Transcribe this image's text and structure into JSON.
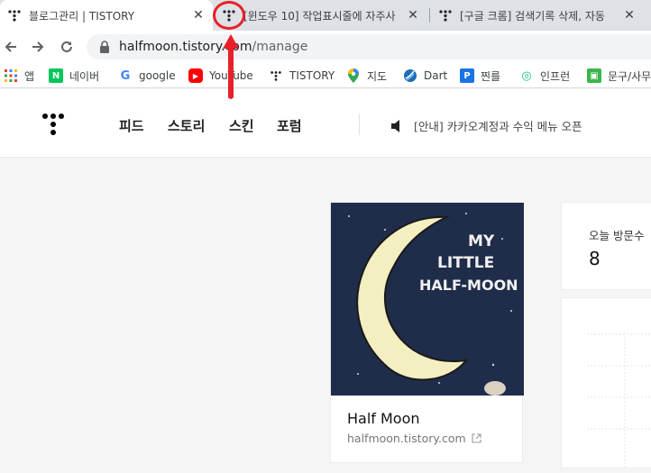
{
  "browser": {
    "tabs": [
      {
        "title": "블로그관리 | TISTORY",
        "active": true
      },
      {
        "title": "[윈도우 10] 작업표시줄에 자주사",
        "active": false
      },
      {
        "title": "[구글 크롬] 검색기록 삭제, 자동",
        "active": false
      }
    ],
    "close_glyph": "✕",
    "url_host": "halfmoon.tistory.com",
    "url_path": "/manage"
  },
  "bookmarks": [
    {
      "label": "앱",
      "icon": "apps-grid-icon"
    },
    {
      "label": "네이버",
      "icon": "naver-icon",
      "color": "#03c75a",
      "glyph": "N"
    },
    {
      "label": "google",
      "icon": "google-icon",
      "color": "#4285f4",
      "glyph": "G"
    },
    {
      "label": "YouTube",
      "icon": "youtube-icon",
      "color": "#ff0000",
      "glyph": "▶"
    },
    {
      "label": "TISTORY",
      "icon": "tistory-icon"
    },
    {
      "label": "지도",
      "icon": "maps-pin-icon"
    },
    {
      "label": "Dart",
      "icon": "dart-icon"
    },
    {
      "label": "찐를",
      "icon": "blue-square-icon",
      "color": "#1a73e8",
      "glyph": "P"
    },
    {
      "label": "인프런",
      "icon": "inflearn-icon",
      "color": "#1dc078",
      "glyph": "◎"
    },
    {
      "label": "문구/사무",
      "icon": "green-square-icon",
      "color": "#3ab54a",
      "glyph": "▣"
    }
  ],
  "site": {
    "menu": [
      "피드",
      "스토리",
      "스킨",
      "포럼"
    ],
    "notice": "[안내] 카카오계정과 수익 메뉴 오픈"
  },
  "blog": {
    "name": "Half Moon",
    "url": "halfmoon.tistory.com",
    "cover_text": [
      "MY",
      "LITTLE",
      "HALF-MOON"
    ]
  },
  "stats": {
    "today_label": "오늘 방문수",
    "today_value": "8"
  },
  "colors": {
    "annotation": "#e8202a",
    "cover_bg": "#1f2d4a",
    "moon": "#f3efc1"
  }
}
